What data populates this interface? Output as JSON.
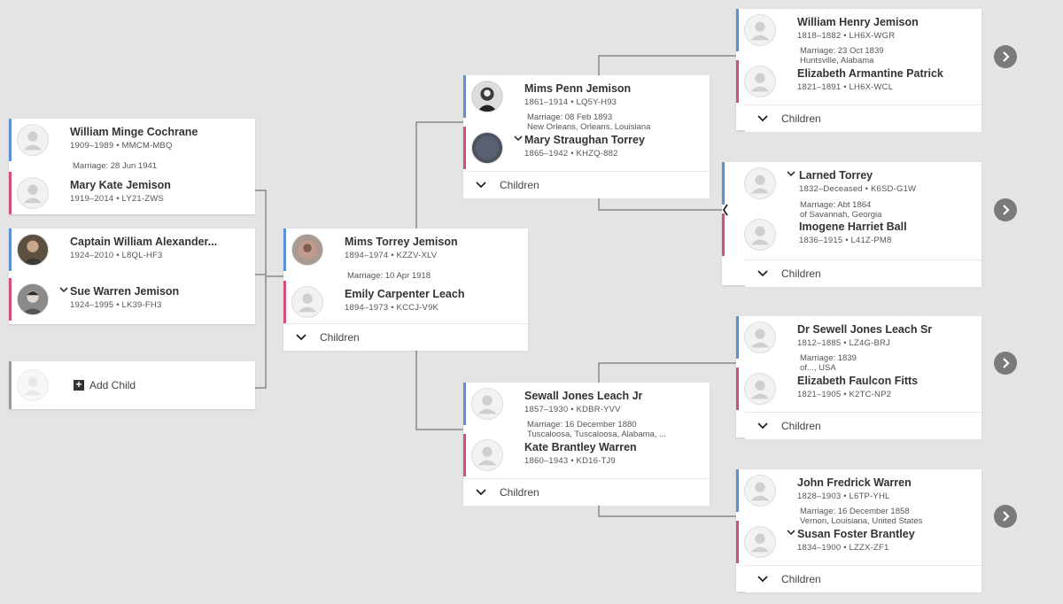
{
  "children_label": "Children",
  "colors": {
    "male": "#5b8fd8",
    "female": "#d44e7a",
    "background": "#e4e4e4",
    "line": "#888888"
  },
  "children_group": {
    "couple": {
      "husband": {
        "name": "William Minge Cochrane",
        "info": "1909–1989 • MMCM-MBQ"
      },
      "marriage": "Marriage: 28 Jun 1941",
      "wife": {
        "name": "Mary Kate Jemison",
        "info": "1919–2014 • LY21-ZWS"
      }
    },
    "couple2": {
      "husband": {
        "name": "Captain William Alexander...",
        "info": "1924–2010 • L8QL-HF3"
      },
      "wife": {
        "name": "Sue Warren Jemison",
        "info": "1924–1995 • LK39-FH3"
      }
    },
    "add_child_label": "Add Child"
  },
  "focus": {
    "husband": {
      "name": "Mims Torrey Jemison",
      "info": "1894–1974 • KZZV-XLV"
    },
    "marriage": "Marriage: 10 Apr 1918",
    "wife": {
      "name": "Emily Carpenter Leach",
      "info": "1894–1973 • KCCJ-V9K"
    }
  },
  "parents_father": {
    "husband": {
      "name": "Mims Penn Jemison",
      "info": "1861–1914 • LQ5Y-H93"
    },
    "marriage1": "Marriage: 08 Feb 1893",
    "marriage2": "New Orleans, Orleans, Louisiana",
    "wife": {
      "name": "Mary Straughan Torrey",
      "info": "1865–1942 • KHZQ-882"
    }
  },
  "parents_mother": {
    "husband": {
      "name": "Sewall Jones Leach Jr",
      "info": "1857–1930 • KDBR-YVV"
    },
    "marriage1": "Marriage: 16 December 1880",
    "marriage2": "Tuscaloosa, Tuscaloosa, Alabama, ...",
    "wife": {
      "name": "Kate Brantley Warren",
      "info": "1860–1943 • KD16-TJ9"
    }
  },
  "gp1": {
    "husband": {
      "name": "William Henry Jemison",
      "info": "1818–1882 • LH6X-WGR"
    },
    "marriage1": "Marriage: 23 Oct 1839",
    "marriage2": "Huntsville, Alabama",
    "wife": {
      "name": "Elizabeth Armantine Patrick",
      "info": "1821–1891 • LH6X-WCL"
    }
  },
  "gp2": {
    "husband": {
      "name": "Larned Torrey",
      "info": "1832–Deceased • K6SD-G1W"
    },
    "marriage1": "Marriage: Abt 1864",
    "marriage2": "of Savannah, Georgia",
    "wife": {
      "name": "Imogene Harriet Ball",
      "info": "1836–1915 • L41Z-PM8"
    }
  },
  "gp3": {
    "husband": {
      "name": "Dr Sewell Jones Leach Sr",
      "info": "1812–1885 • LZ4G-BRJ"
    },
    "marriage1": "Marriage: 1839",
    "marriage2": "of..., USA",
    "wife": {
      "name": "Elizabeth Faulcon Fitts",
      "info": "1821–1905 • K2TC-NP2"
    }
  },
  "gp4": {
    "husband": {
      "name": "John Fredrick Warren",
      "info": "1828–1903 • L6TP-YHL"
    },
    "marriage1": "Marriage: 16 December 1858",
    "marriage2": "Vernon, Louisiana, United States",
    "wife": {
      "name": "Susan Foster Brantley",
      "info": "1834–1900 • LZZX-ZF1"
    }
  }
}
